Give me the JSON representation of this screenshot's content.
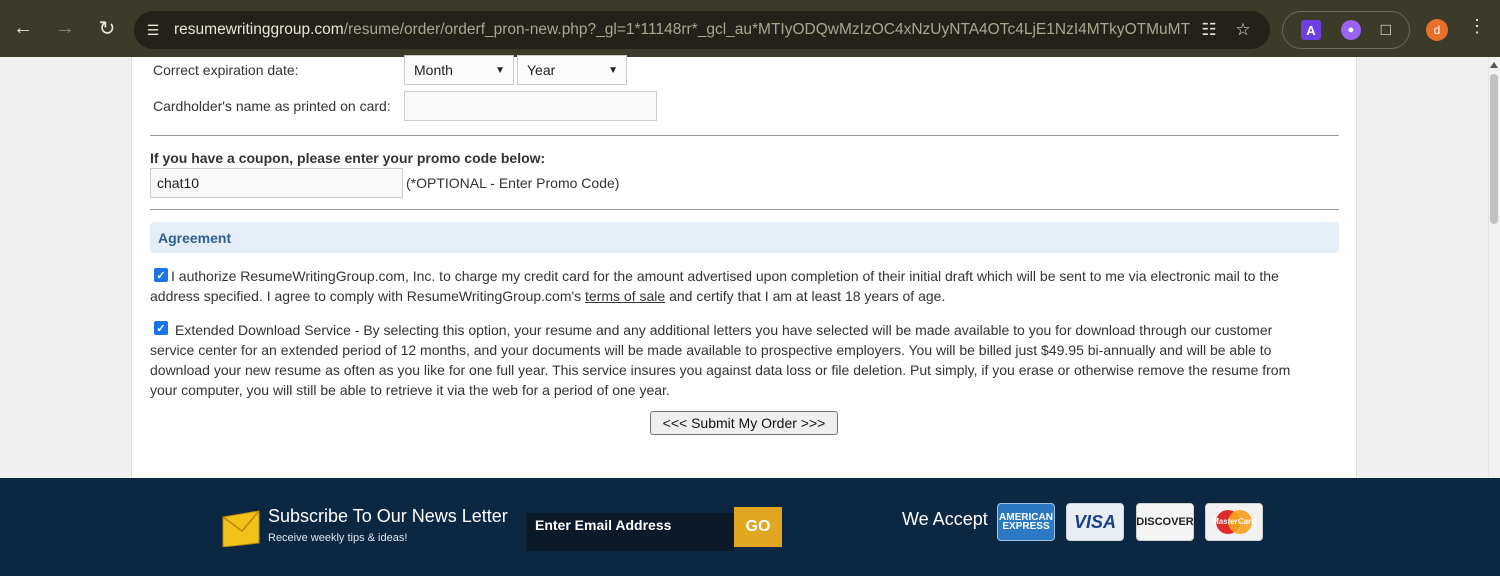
{
  "browser": {
    "url_host": "resumewritinggroup.com",
    "url_path": "/resume/order/orderf_pron-new.php?_gl=1*11148rr*_gcl_au*MTIyODQwMzIzOC4xNzUyNTA4OTc4LjE1NzI4MTkyOTMuMT...",
    "ext_a_label": "A",
    "profile_initial": "d"
  },
  "form": {
    "expiration_label": "Correct expiration date:",
    "month_select": "Month",
    "year_select": "Year",
    "cardholder_label": "Cardholder's name as printed on card:",
    "cardholder_value": "",
    "coupon_label": "If you have a coupon, please enter your promo code below:",
    "promo_value": "chat10",
    "promo_hint": "(*OPTIONAL - Enter Promo Code)"
  },
  "agreement": {
    "heading": "Agreement",
    "authorize_checked": true,
    "authorize_text_1": "I authorize ResumeWritingGroup.com, Inc. to charge my credit card for the amount advertised upon completion of their initial draft which will be sent to me via electronic mail to the",
    "authorize_text_2a": "address specified. I agree to comply with ResumeWritingGroup.com's ",
    "terms_link": "terms of sale",
    "authorize_text_2b": " and certify that I am at least 18 years of age.",
    "extended_checked": true,
    "extended_line_1": "Extended Download Service - By selecting this option, your resume and any additional letters you have selected will be made available to you for download through our customer",
    "extended_line_2": "service center for an extended period of 12 months, and your documents will be made available to prospective employers. You will be billed just $49.95 bi-annually and will be able to",
    "extended_line_3": "download your new resume as often as you like for one full year. This service insures you against data loss or file deletion. Put simply, if you erase or otherwise remove the resume from",
    "extended_line_4": "your computer, you will still be able to retrieve it via the web for a period of one year.",
    "submit_label": "<<< Submit My Order >>>"
  },
  "footer": {
    "newsletter_title": "Subscribe To Our News Letter",
    "newsletter_sub": "Receive weekly tips & ideas!",
    "email_placeholder": "Enter Email Address",
    "go_label": "GO",
    "we_accept": "We Accept",
    "cards": {
      "amex": "AMERICAN EXPRESS",
      "visa": "VISA",
      "discover": "DISCOVER",
      "mastercard": "MasterCard"
    }
  },
  "colors": {
    "footer_bg": "#0c2742",
    "go_button": "#e2a620",
    "agreement_bar": "#e5eef7",
    "agreement_text": "#2e5f8e",
    "checkbox": "#1a73e8"
  }
}
